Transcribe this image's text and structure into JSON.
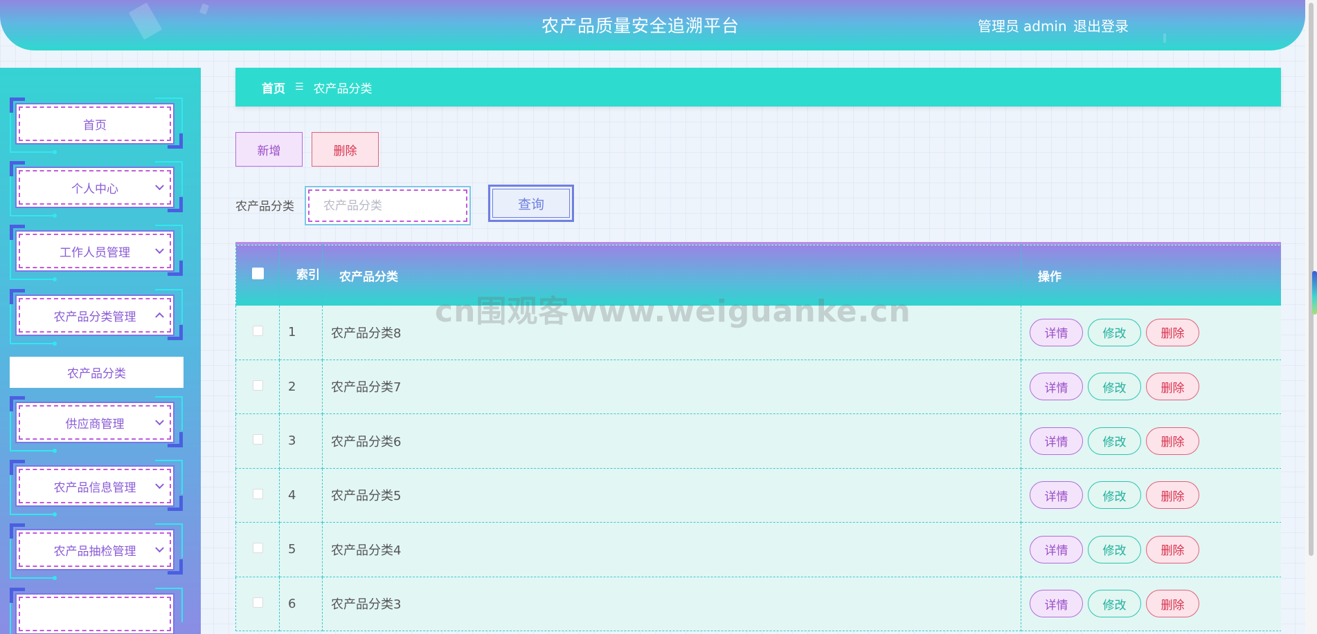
{
  "header": {
    "title": "农产品质量安全追溯平台",
    "user_role": "管理员",
    "user_name": "admin",
    "logout": "退出登录"
  },
  "sidebar": {
    "items": [
      {
        "label": "首页",
        "chevron": ""
      },
      {
        "label": "个人中心",
        "chevron": "down"
      },
      {
        "label": "工作人员管理",
        "chevron": "down"
      },
      {
        "label": "农产品分类管理",
        "chevron": "up"
      },
      {
        "label": "供应商管理",
        "chevron": "down"
      },
      {
        "label": "农产品信息管理",
        "chevron": "down"
      },
      {
        "label": "农产品抽检管理",
        "chevron": "down"
      }
    ],
    "active_sub": "农产品分类"
  },
  "breadcrumb": {
    "home": "首页",
    "separator": "☰",
    "current": "农产品分类"
  },
  "toolbar": {
    "add": "新增",
    "delete": "删除"
  },
  "search": {
    "label": "农产品分类",
    "placeholder": "农产品分类",
    "value": "",
    "button": "查询"
  },
  "table": {
    "columns": [
      "索引",
      "农产品分类",
      "操作"
    ],
    "rows": [
      {
        "index": "1",
        "name": "农产品分类8"
      },
      {
        "index": "2",
        "name": "农产品分类7"
      },
      {
        "index": "3",
        "name": "农产品分类6"
      },
      {
        "index": "4",
        "name": "农产品分类5"
      },
      {
        "index": "5",
        "name": "农产品分类4"
      },
      {
        "index": "6",
        "name": "农产品分类3"
      }
    ],
    "actions": {
      "detail": "详情",
      "edit": "修改",
      "delete": "删除"
    }
  },
  "watermark": "cn围观客www.weiguanke.cn",
  "colors": {
    "accent_teal": "#2ddccf",
    "accent_purple": "#9b4fc8",
    "accent_red": "#d8334f",
    "accent_blue": "#6f7fe0"
  }
}
